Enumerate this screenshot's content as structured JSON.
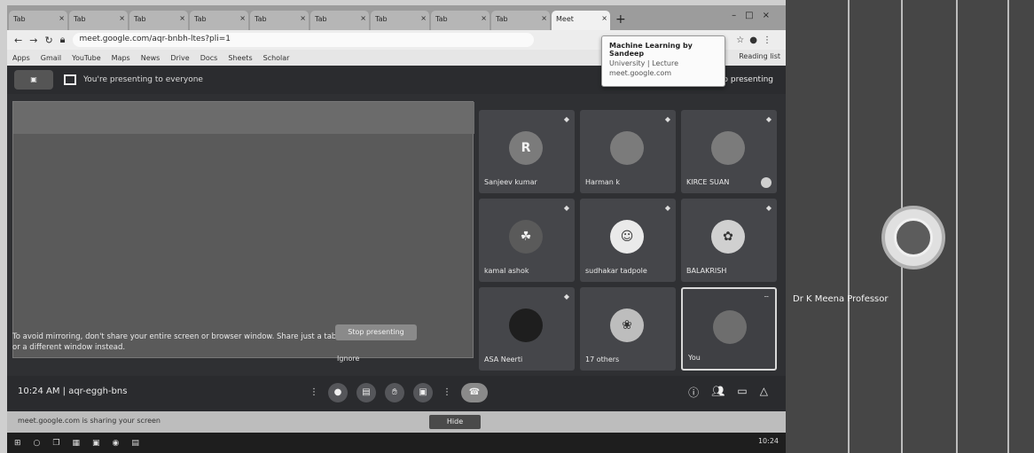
{
  "browser": {
    "tabs": [
      "Tab",
      "Tab",
      "Tab",
      "Tab",
      "Tab",
      "Tab",
      "Tab",
      "Tab",
      "Tab",
      "Meet"
    ],
    "url": "meet.google.com/aqr-bnbh-ltes?pli=1",
    "bookmarks": [
      "Apps",
      "Gmail",
      "YouTube",
      "Maps",
      "News",
      "Drive",
      "Docs",
      "Sheets",
      "Scholar",
      "Reading list"
    ],
    "tooltip": {
      "title": "Machine Learning by Sandeep",
      "line1": "University | Lecture",
      "line2": "meet.google.com"
    }
  },
  "meet": {
    "presenting_label": "You're presenting to everyone",
    "stop_presenting": "Stop presenting",
    "mirror_warning": "To avoid mirroring, don't share your entire screen or browser window. Share just a tab or a different window instead.",
    "stop_sharing": "Stop presenting",
    "ignore": "Ignore",
    "time": "10:24 AM",
    "meeting_code": "aqr-eggh-bns",
    "participants": [
      {
        "name": "Sanjeev kumar",
        "initial": "R"
      },
      {
        "name": "Harman k",
        "initial": ""
      },
      {
        "name": "KIRCE SUAN",
        "initial": ""
      },
      {
        "name": "kamal ashok",
        "initial": ""
      },
      {
        "name": "sudhakar tadpole",
        "initial": ""
      },
      {
        "name": "BALAKRISH",
        "initial": ""
      },
      {
        "name": "ASA Neerti",
        "initial": ""
      },
      {
        "name": "17 others",
        "initial": ""
      },
      {
        "name": "You",
        "initial": ""
      }
    ]
  },
  "bottom": {
    "hint": "meet.google.com is sharing your screen",
    "hide": "Hide"
  },
  "taskbar": {
    "time": "10:24"
  },
  "presenter": {
    "name": "Dr K Meena Professor"
  }
}
